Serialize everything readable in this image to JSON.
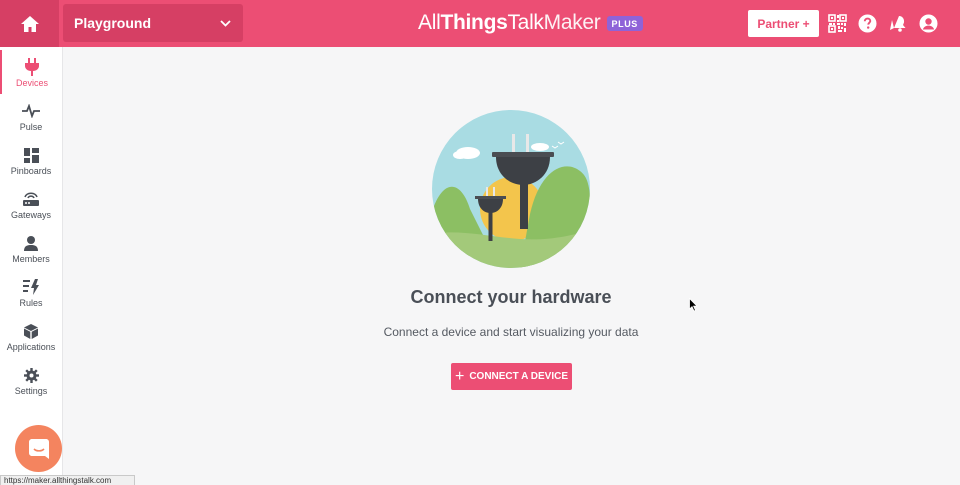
{
  "header": {
    "workspace": "Playground",
    "logo": {
      "part1": "All",
      "part2": "Things",
      "part3": "Talk",
      "part4": "Maker",
      "badge": "PLUS"
    },
    "partner_label": "Partner +",
    "icons": [
      "home-icon",
      "chevron-down-icon",
      "qr-code-icon",
      "help-icon",
      "notification-icon",
      "account-icon"
    ]
  },
  "sidebar": {
    "items": [
      {
        "label": "Devices",
        "icon": "plug-icon",
        "active": true
      },
      {
        "label": "Pulse",
        "icon": "pulse-icon"
      },
      {
        "label": "Pinboards",
        "icon": "pinboards-icon"
      },
      {
        "label": "Gateways",
        "icon": "gateway-icon"
      },
      {
        "label": "Members",
        "icon": "members-icon"
      },
      {
        "label": "Rules",
        "icon": "rules-icon"
      },
      {
        "label": "Applications",
        "icon": "applications-icon"
      },
      {
        "label": "Settings",
        "icon": "gear-icon"
      }
    ]
  },
  "main": {
    "title": "Connect your hardware",
    "subtitle": "Connect a device and start visualizing your data",
    "button_label": "CONNECT A DEVICE"
  },
  "status_bar": {
    "url": "https://maker.allthingstalk.com"
  },
  "colors": {
    "brand": "#ec4e74",
    "brand_dark": "#d63f64",
    "plus_badge": "#8f63d8",
    "chat": "#f4845f"
  }
}
